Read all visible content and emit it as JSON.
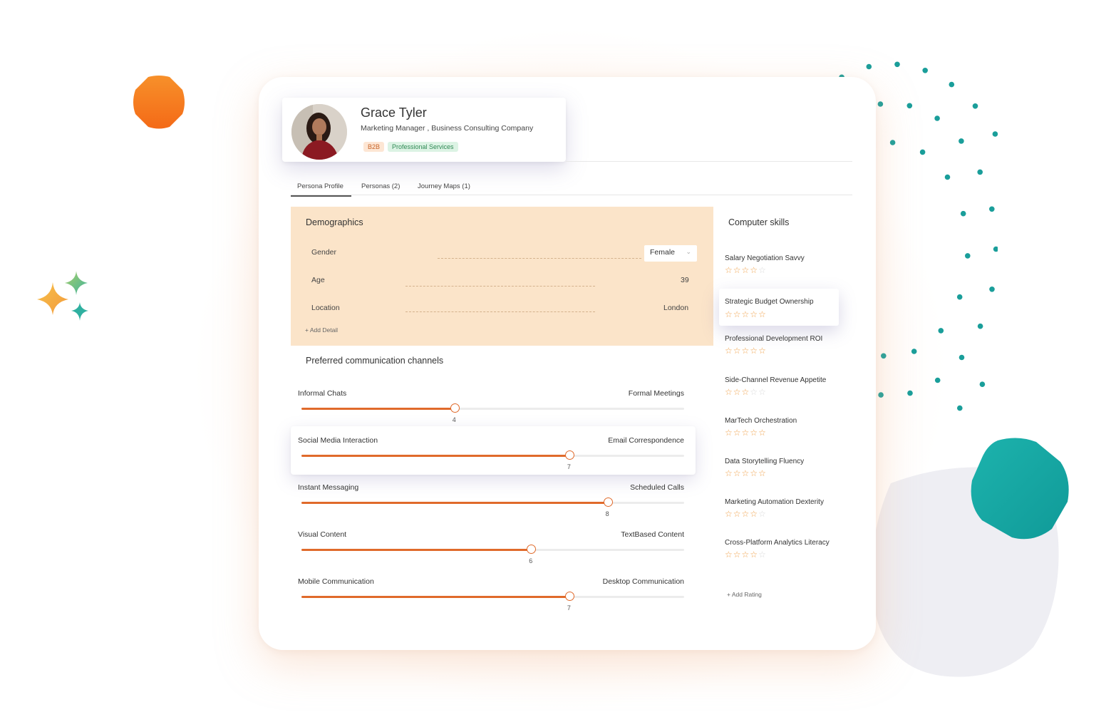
{
  "profile": {
    "name": "Grace Tyler",
    "role": "Marketing Manager , Business Consulting Company",
    "tags": [
      "B2B",
      "Professional Services"
    ]
  },
  "tabs": [
    "Persona Profile",
    "Personas (2)",
    "Journey Maps (1)"
  ],
  "demographics": {
    "title": "Demographics",
    "rows": [
      {
        "label": "Gender",
        "value": "Female"
      },
      {
        "label": "Age",
        "value": "39"
      },
      {
        "label": "Location",
        "value": "London"
      }
    ],
    "add_label": "+ Add Detail"
  },
  "channels": {
    "title": "Preferred communication channels",
    "sliders": [
      {
        "left": "Informal Chats",
        "right": "Formal Meetings",
        "value": 4,
        "max": 10
      },
      {
        "left": "Social Media Interaction",
        "right": "Email Correspondence",
        "value": 7,
        "max": 10
      },
      {
        "left": "Instant Messaging",
        "right": "Scheduled Calls",
        "value": 8,
        "max": 10
      },
      {
        "left": "Visual Content",
        "right": "TextBased Content",
        "value": 6,
        "max": 10
      },
      {
        "left": "Mobile Communication",
        "right": "Desktop Communication",
        "value": 7,
        "max": 10
      }
    ]
  },
  "skills": {
    "title": "Computer skills",
    "items": [
      {
        "name": "Salary Negotiation Savvy",
        "rating": 4
      },
      {
        "name": "Strategic Budget Ownership",
        "rating": 5
      },
      {
        "name": "Professional Development ROI",
        "rating": 5
      },
      {
        "name": "Side-Channel Revenue Appetite",
        "rating": 3
      },
      {
        "name": "MarTech Orchestration",
        "rating": 5
      },
      {
        "name": "Data Storytelling Fluency",
        "rating": 5
      },
      {
        "name": "Marketing Automation Dexterity",
        "rating": 4
      },
      {
        "name": "Cross-Platform Analytics Literacy",
        "rating": 4
      }
    ],
    "add_label": "+ Add Rating"
  },
  "colors": {
    "accent": "#e06a2b",
    "demographics_bg": "#fbe4c9",
    "star": "#f0a14a",
    "teal": "#1fa9a5",
    "orange_blob": "#f47c20"
  }
}
